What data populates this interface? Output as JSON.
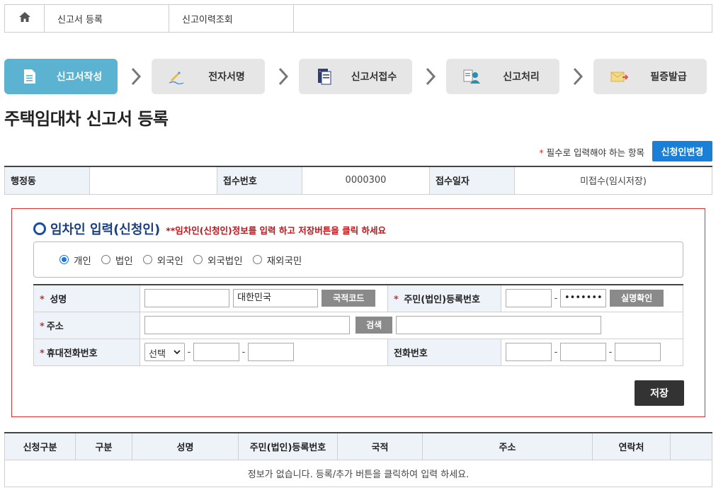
{
  "topnav": {
    "home_icon": "home-icon",
    "items": [
      {
        "label": "신고서 등록"
      },
      {
        "label": "신고이력조회"
      }
    ]
  },
  "steps": [
    {
      "label": "신고서작성",
      "icon": "document-icon",
      "active": true
    },
    {
      "label": "전자서명",
      "icon": "pen-sign-icon",
      "active": false
    },
    {
      "label": "신고서접수",
      "icon": "file-submit-icon",
      "active": false
    },
    {
      "label": "신고처리",
      "icon": "user-process-icon",
      "active": false
    },
    {
      "label": "필증발급",
      "icon": "certificate-icon",
      "active": false
    }
  ],
  "page_title": "주택임대차 신고서 등록",
  "required_note": {
    "star": "*",
    "text": " 필수로 입력해야 하는 항목"
  },
  "change_button": "신청인변경",
  "info": {
    "dong_label": "행정동",
    "dong_value": "",
    "receipt_no_label": "접수번호",
    "receipt_no_value": "0000300",
    "receipt_date_label": "접수일자",
    "receipt_date_value": "미접수(임시저장)"
  },
  "section": {
    "title": "임차인 입력(신청인)",
    "warning": "**임차인(신청인)정보를 입력 하고 저장버튼을 클릭 하세요",
    "radios": [
      {
        "label": "개인",
        "checked": true
      },
      {
        "label": "법인",
        "checked": false
      },
      {
        "label": "외국인",
        "checked": false
      },
      {
        "label": "외국법인",
        "checked": false
      },
      {
        "label": "재외국민",
        "checked": false
      }
    ],
    "form": {
      "name_label": "성명",
      "name_value": "",
      "nation_value": "대한민국",
      "nation_code_button": "국적코드",
      "rrn_label": "주민(법인)등록번호",
      "rrn_front": "",
      "rrn_back": "•••••••",
      "verify_button": "실명확인",
      "address_label": "주소",
      "address_value": "",
      "search_button": "검색",
      "address_detail": "",
      "mobile_label": "휴대전화번호",
      "mobile_select": "선택",
      "mobile_mid": "",
      "mobile_last": "",
      "phone_label": "전화번호",
      "phone_1": "",
      "phone_2": "",
      "phone_3": "",
      "required_star": "*",
      "dash": "-"
    },
    "save_button": "저장"
  },
  "list": {
    "columns": [
      "신청구분",
      "구분",
      "성명",
      "주민(법인)등록번호",
      "국적",
      "주소",
      "연락처",
      ""
    ],
    "empty_message": "정보가 없습니다.   등록/추가 버튼을 클릭하여 입력 하세요."
  },
  "colors": {
    "active_step": "#5cb3d1",
    "inactive_step": "#e6e6e6",
    "primary_button": "#1a7fd6",
    "section_border": "#dd3333",
    "header_bg": "#eef3fa",
    "warning_text": "#c0141b"
  }
}
